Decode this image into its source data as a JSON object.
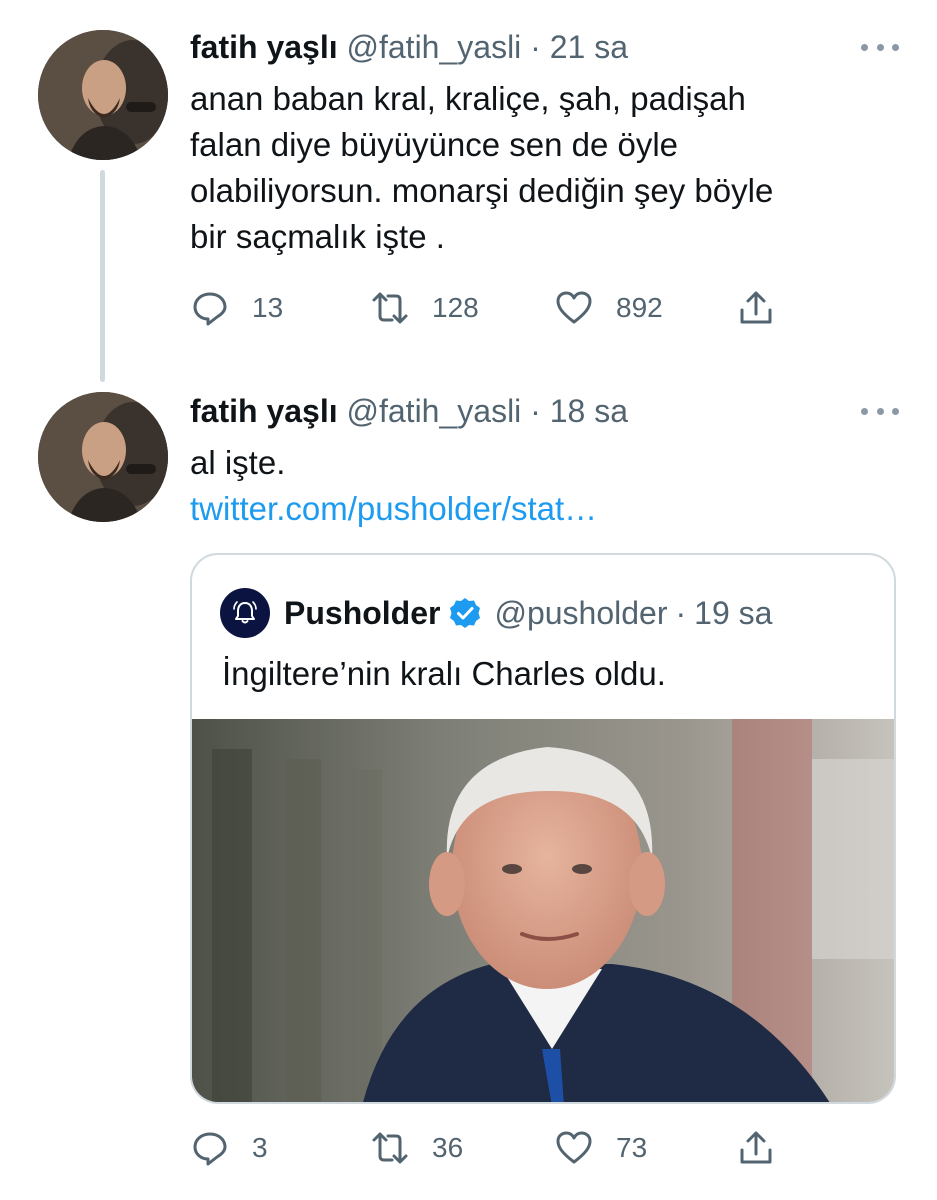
{
  "tweets": [
    {
      "author_name": "fatih yaşlı",
      "author_handle": "@fatih_yasli",
      "separator": "·",
      "time": "21 sa",
      "text_lines": [
        "anan baban kral, kraliçe, şah, padişah",
        "falan diye büyüyünce sen de öyle",
        "olabiliyorsun. monarşi dediğin şey böyle",
        "bir saçmalık işte ."
      ],
      "stats": {
        "replies": "13",
        "retweets": "128",
        "likes": "892"
      }
    },
    {
      "author_name": "fatih yaşlı",
      "author_handle": "@fatih_yasli",
      "separator": "·",
      "time": "18 sa",
      "text": "al işte.",
      "link": "twitter.com/pusholder/stat…",
      "quoted": {
        "author_name": "Pusholder",
        "author_handle": "@pusholder",
        "separator": "·",
        "time": "19 sa",
        "text": "İngiltere’nin kralı Charles oldu."
      },
      "stats": {
        "replies": "3",
        "retweets": "36",
        "likes": "73"
      }
    }
  ],
  "icons": {
    "reply": "reply-icon",
    "retweet": "retweet-icon",
    "like": "heart-icon",
    "share": "share-icon",
    "more": "more-options-icon",
    "verified": "verified-badge-icon",
    "pusholder_logo": "bell-icon"
  },
  "colors": {
    "text": "#0f1419",
    "secondary": "#536471",
    "link": "#1d9bf0",
    "border": "#cfd9de",
    "verified": "#1d9bf0"
  }
}
